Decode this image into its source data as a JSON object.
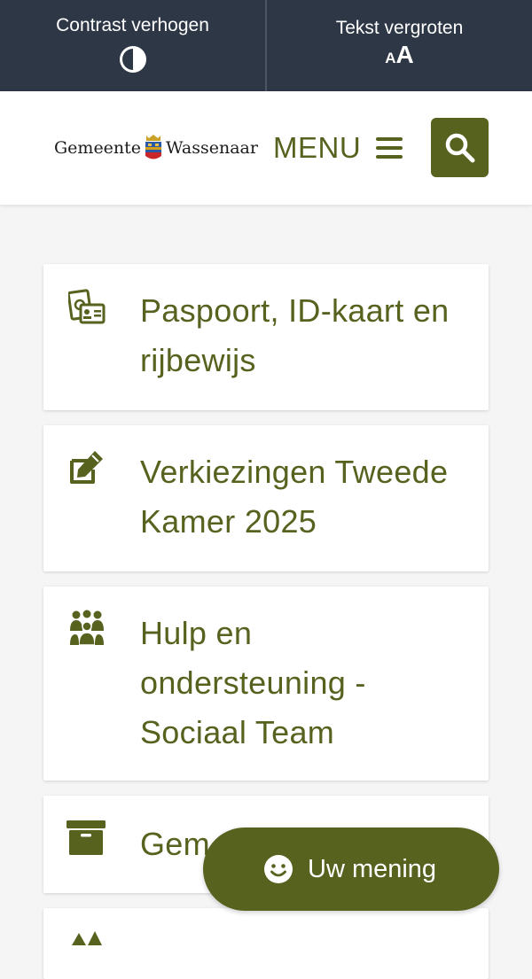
{
  "accessibility": {
    "contrast_label": "Contrast verhogen",
    "textsize_label": "Tekst vergroten",
    "textsize_small": "A",
    "textsize_big": "A",
    "contrast_icon": "half-circle-contrast-icon"
  },
  "header": {
    "logo_left": "Gemeente",
    "logo_right": "Wassenaar",
    "menu_label": "MENU",
    "search_icon": "search-icon"
  },
  "cards": [
    {
      "title": "Paspoort, ID-kaart en rijbewijs",
      "icon": "id-card-icon"
    },
    {
      "title": "Verkiezingen Tweede Kamer 2025",
      "icon": "pencil-edit-icon"
    },
    {
      "title": "Hulp en ondersteuning - Sociaal Team",
      "icon": "people-group-icon"
    },
    {
      "title": "Gem",
      "icon": "archive-box-icon"
    },
    {
      "title": "",
      "icon": "trees-icon"
    }
  ],
  "feedback": {
    "label": "Uw mening",
    "icon": "smiley-icon"
  },
  "colors": {
    "brand_green": "#56621e",
    "topbar": "#2d3746",
    "background": "#f5f5f5"
  }
}
